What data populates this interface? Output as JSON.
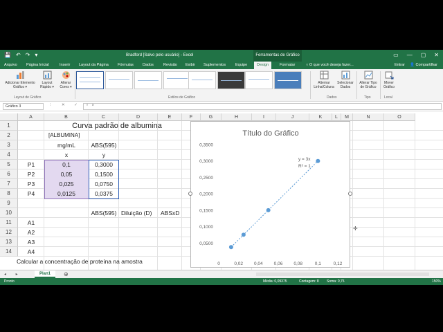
{
  "window": {
    "quick_access": [
      "💾",
      "↶",
      "↷",
      "▾"
    ],
    "title": "Bradford [Salvo pelo usuário] - Excel",
    "context_tab_group": "Ferramentas de Gráfico",
    "controls": [
      "▭",
      "—",
      "▢",
      "✕"
    ]
  },
  "ribbon": {
    "tabs": [
      "Arquivo",
      "Página Inicial",
      "Inserir",
      "Layout da Página",
      "Fórmulas",
      "Dados",
      "Revisão",
      "Exibir",
      "Suplementos",
      "Equipe",
      "Design",
      "Formatar"
    ],
    "active_tab": "Design",
    "tell_me": "O que você deseja fazer...",
    "sign_in": "Entrar",
    "share": "Compartilhar",
    "buttons": {
      "add_element": "Adicionar Elemento\nGráfico ▾",
      "quick_layout": "Layout\nRápido ▾",
      "change_colors": "Alterar\nCores ▾",
      "switch_row_col": "Alternar\nLinha/Coluna",
      "select_data": "Selecionar\nDados",
      "change_type": "Alterar Tipo\nde Gráfico",
      "move_chart": "Mover\nGráfico"
    },
    "groups": {
      "layouts": "Layout de Gráfico",
      "styles": "Estilos de Gráfico",
      "data": "Dados",
      "type": "Tipo",
      "location": "Local"
    }
  },
  "formula_bar": {
    "name_box": "Gráfico 3",
    "fx_icons": "⋮ ✕ ✓ fx",
    "formula": ""
  },
  "columns": [
    "A",
    "B",
    "C",
    "D",
    "E",
    "F",
    "G",
    "H",
    "I",
    "J",
    "K",
    "L",
    "M",
    "N",
    "O"
  ],
  "rows": [
    "1",
    "2",
    "3",
    "4",
    "5",
    "6",
    "7",
    "8",
    "9",
    "10",
    "11",
    "12",
    "13",
    "14"
  ],
  "cells": {
    "title": "Curva padrão de albumina",
    "b2a": "[ALBUMINA]",
    "b2b": "mg/mL",
    "c2": "ABS(595)",
    "b3": "x",
    "c3": "y",
    "p1": "P1",
    "p2": "P2",
    "p3": "P3",
    "p4": "P4",
    "b4": "0,1",
    "b5": "0,05",
    "b6": "0,025",
    "b7": "0,0125",
    "c4": "0,3000",
    "c5": "0,1500",
    "c6": "0,0750",
    "c7": "0,0375",
    "c9": "ABS(595)",
    "d9": "Diluição (D)",
    "e9": "ABSxD",
    "a10": "A1",
    "a11": "A2",
    "a12": "A3",
    "a13": "A4",
    "a14": "Calcular a concentração de proteína na amostra"
  },
  "chart_data": {
    "type": "scatter",
    "title": "Título do Gráfico",
    "x": [
      0.0125,
      0.025,
      0.05,
      0.1
    ],
    "y": [
      0.0375,
      0.075,
      0.15,
      0.3
    ],
    "xlim": [
      0,
      0.12
    ],
    "ylim": [
      0,
      0.35
    ],
    "x_ticks": [
      "0",
      "0,02",
      "0,04",
      "0,06",
      "0,08",
      "0,1",
      "0,12"
    ],
    "y_ticks": [
      "0,0500",
      "0,1000",
      "0,1500",
      "0,2000",
      "0,2500",
      "0,3000",
      "0,3500"
    ],
    "trendline": "linear",
    "equation": "y = 3x",
    "r_squared": "R² = 1",
    "grid": false,
    "marker_color": "#5b9bd5"
  },
  "sheets": [
    "Plan1"
  ],
  "status_bar": {
    "mode": "Pronto",
    "average": "Média: 0,09375",
    "count": "Contagem: 8",
    "sum": "Soma: 0,75",
    "zoom": "150%"
  }
}
